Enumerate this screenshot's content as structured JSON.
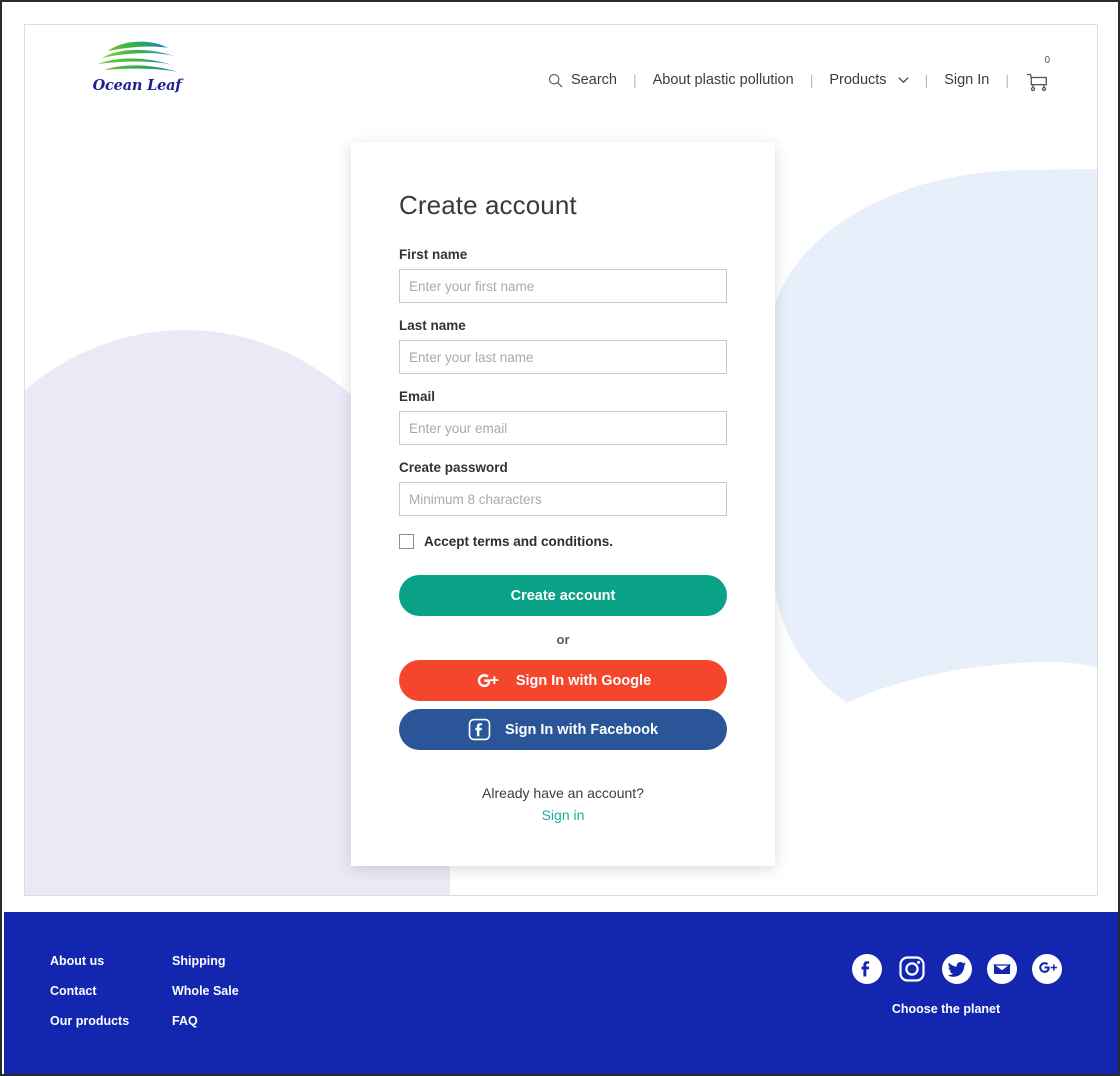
{
  "brand": {
    "name": "Ocean Leaf",
    "logo_icon": "ocean-leaf-logo",
    "colors": {
      "leaf_green": "#5cb82e",
      "leaf_blue": "#1b7fc4",
      "wordmark": "#1e1e96",
      "teal": "#0aa287",
      "link_teal": "#14b39a",
      "google_red": "#f4462d",
      "facebook_blue": "#2a5699",
      "footer_blue": "#1226b0",
      "blob_lavender": "#ece9f7",
      "blob_blue": "#e7effa"
    }
  },
  "header": {
    "search": {
      "label": "Search",
      "icon": "search-icon"
    },
    "separator": "|",
    "items": [
      {
        "label": "About plastic pollution"
      },
      {
        "label": "Products",
        "icon": "chevron-down-icon"
      },
      {
        "label": "Sign In"
      }
    ],
    "cart": {
      "icon": "shopping-cart-icon",
      "count": "0"
    }
  },
  "form": {
    "title": "Create account",
    "fields": [
      {
        "label": "First name",
        "placeholder": "Enter your first name",
        "value": "",
        "type": "text",
        "name": "first-name"
      },
      {
        "label": "Last name",
        "placeholder": "Enter your last name",
        "value": "",
        "type": "text",
        "name": "last-name"
      },
      {
        "label": "Email",
        "placeholder": "Enter your email",
        "value": "",
        "type": "text",
        "name": "email"
      },
      {
        "label": "Create password",
        "placeholder": "Minimum 8 characters",
        "value": "",
        "type": "password",
        "name": "password"
      }
    ],
    "terms": {
      "label": "Accept terms and conditions.",
      "checked": false
    },
    "submit_label": "Create account",
    "divider_label": "or",
    "social_buttons": [
      {
        "label": "Sign In with Google",
        "icon": "google-plus-icon"
      },
      {
        "label": "Sign In with Facebook",
        "icon": "facebook-icon"
      }
    ],
    "footer_prompt": "Already have an account?",
    "footer_link": "Sign in"
  },
  "footer": {
    "columns": [
      {
        "links": [
          "About us",
          "Contact",
          "Our products"
        ]
      },
      {
        "links": [
          "Shipping",
          "Whole Sale",
          "FAQ"
        ]
      }
    ],
    "social": [
      {
        "icon": "facebook-icon",
        "style": "filled"
      },
      {
        "icon": "instagram-icon",
        "style": "outline"
      },
      {
        "icon": "twitter-icon",
        "style": "filled"
      },
      {
        "icon": "email-icon",
        "style": "filled"
      },
      {
        "icon": "google-plus-icon",
        "style": "filled"
      }
    ],
    "tagline": "Choose the planet"
  }
}
